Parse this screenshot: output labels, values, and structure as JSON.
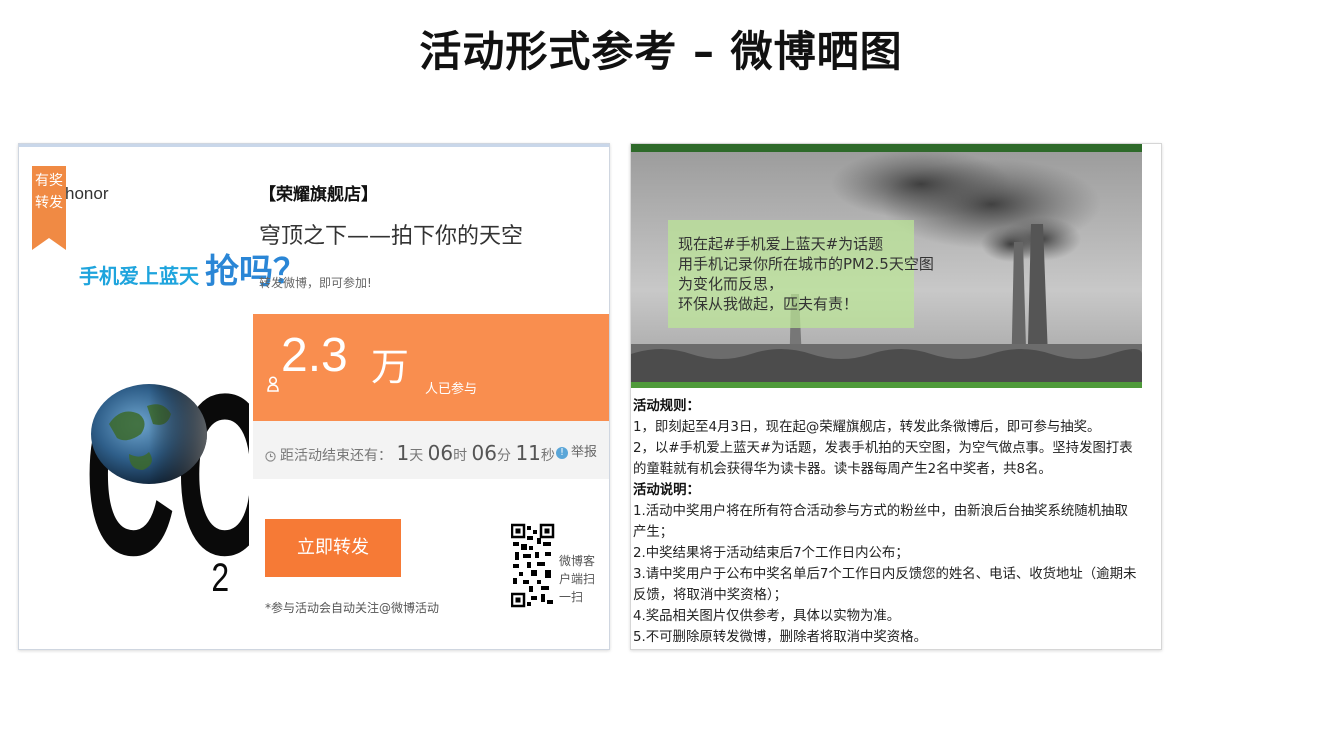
{
  "slide": {
    "title": "活动形式参考 – 微博晒图"
  },
  "left": {
    "badge_line1": "有奖",
    "badge_line2": "转发",
    "brand": "honor",
    "slogan": "手机爱上蓝天",
    "slogan_emphasis": "抢吗？",
    "co2_letters": "CO",
    "co2_sub": "2",
    "store": "【荣耀旗舰店】",
    "headline": "穹顶之下——拍下你的天空",
    "hint": "转发微博，即可参加!",
    "count_number": "2.3",
    "count_unit": "万",
    "count_suffix": "人已参与",
    "countdown_prefix": "距活动结束还有：",
    "days_value": "1",
    "days_unit": "天",
    "hours_value": "06",
    "hours_unit": "时",
    "minutes_value": "06",
    "minutes_unit": "分",
    "seconds_value": "11",
    "seconds_unit": "秒",
    "report_label": "举报",
    "forward_button": "立即转发",
    "auto_follow_note": "*参与活动会自动关注@微博活动",
    "qr_label": "微博客户端扫一扫",
    "colors": {
      "accent": "#f98e4f",
      "button": "#f67a36",
      "brand_blue": "#1ea4dd"
    }
  },
  "right": {
    "note_lines": [
      "现在起#手机爱上蓝天#为话题",
      "用手机记录你所在城市的PM2.5天空图",
      "为变化而反思，",
      "环保从我做起，匹夫有责！"
    ],
    "rules_title": "活动规则：",
    "rules": [
      "1，即刻起至4月3日，现在起@荣耀旗舰店，转发此条微博后，即可参与抽奖。",
      "2，以#手机爱上蓝天#为话题，发表手机拍的天空图，为空气做点事。坚持发图打表的童鞋就有机会获得华为读卡器。读卡器每周产生2名中奖者，共8名。"
    ],
    "notes_title": "活动说明：",
    "notes": [
      "1.活动中奖用户将在所有符合活动参与方式的粉丝中，由新浪后台抽奖系统随机抽取产生；",
      "2.中奖结果将于活动结束后7个工作日内公布；",
      "3.请中奖用户于公布中奖名单后7个工作日内反馈您的姓名、电话、收货地址（逾期未反馈，将取消中奖资格）；",
      "4.奖品相关图片仅供参考，具体以实物为准。",
      "5.不可删除原转发微博，删除者将取消中奖资格。"
    ]
  }
}
